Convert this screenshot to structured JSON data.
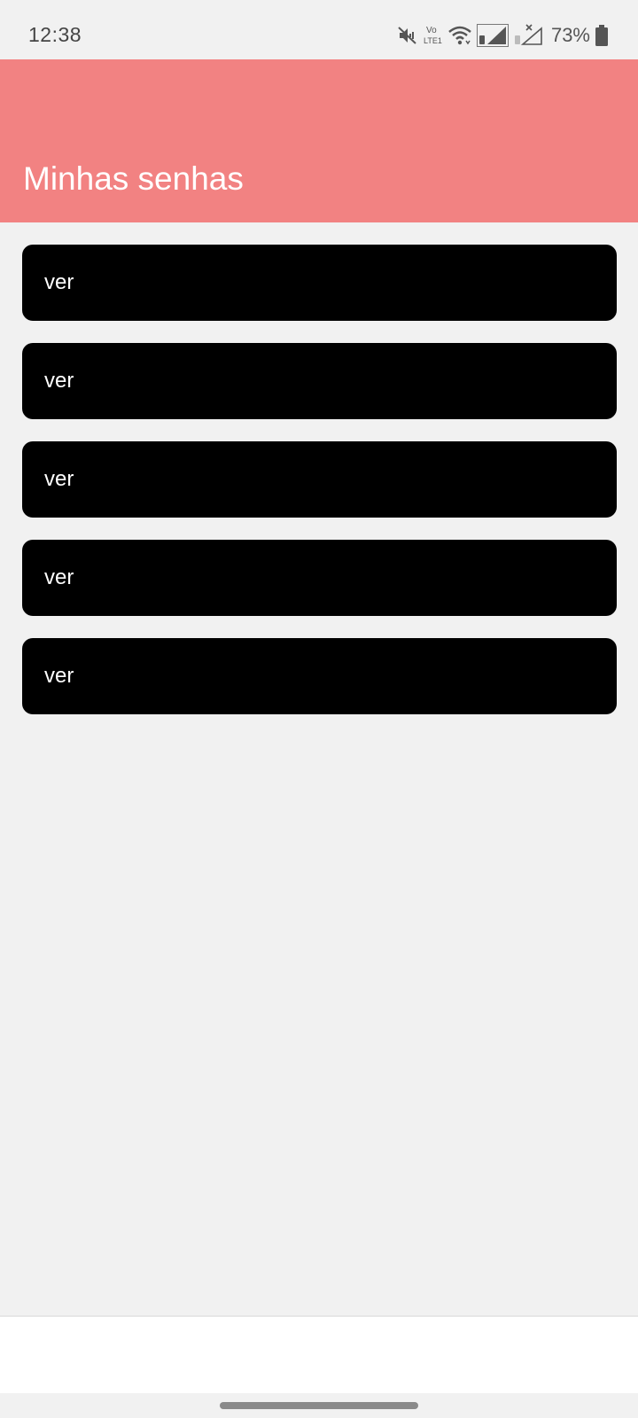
{
  "status_bar": {
    "time": "12:38",
    "battery_percent": "73%",
    "icons": [
      "mute-icon",
      "volte-icon",
      "wifi-icon",
      "signal-sim1-icon",
      "signal-sim2-no-service-icon",
      "battery-icon"
    ],
    "volte_label_top": "Vo",
    "volte_label_bottom": "LTE1",
    "battery_level": 0.73
  },
  "header": {
    "title": "Minhas senhas",
    "background_color": "#f28282"
  },
  "passwords": {
    "items": [
      {
        "label": "ver"
      },
      {
        "label": "ver"
      },
      {
        "label": "ver"
      },
      {
        "label": "ver"
      },
      {
        "label": "ver"
      }
    ]
  }
}
